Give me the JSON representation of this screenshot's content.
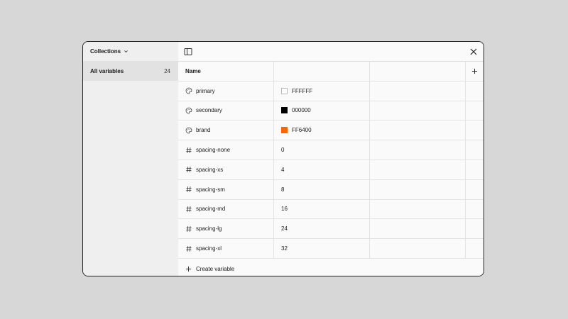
{
  "sidebar": {
    "collections_label": "Collections",
    "all_variables": {
      "label": "All variables",
      "count": "24"
    }
  },
  "table": {
    "header": {
      "name": "Name",
      "col2": "",
      "col3": ""
    },
    "rows": [
      {
        "type": "color",
        "icon": "palette-icon",
        "name": "primary",
        "value": "FFFFFF",
        "swatch": "#FFFFFF"
      },
      {
        "type": "color",
        "icon": "palette-icon",
        "name": "secondary",
        "value": "000000",
        "swatch": "#000000"
      },
      {
        "type": "color",
        "icon": "palette-icon",
        "name": "brand",
        "value": "FF6400",
        "swatch": "#FF6400"
      },
      {
        "type": "number",
        "icon": "hash-icon",
        "name": "spacing-none",
        "value": "0"
      },
      {
        "type": "number",
        "icon": "hash-icon",
        "name": "spacing-xs",
        "value": "4"
      },
      {
        "type": "number",
        "icon": "hash-icon",
        "name": "spacing-sm",
        "value": "8"
      },
      {
        "type": "number",
        "icon": "hash-icon",
        "name": "spacing-md",
        "value": "16"
      },
      {
        "type": "number",
        "icon": "hash-icon",
        "name": "spacing-lg",
        "value": "24"
      },
      {
        "type": "number",
        "icon": "hash-icon",
        "name": "spacing-xl",
        "value": "32"
      }
    ]
  },
  "footer": {
    "create_label": "Create variable"
  }
}
